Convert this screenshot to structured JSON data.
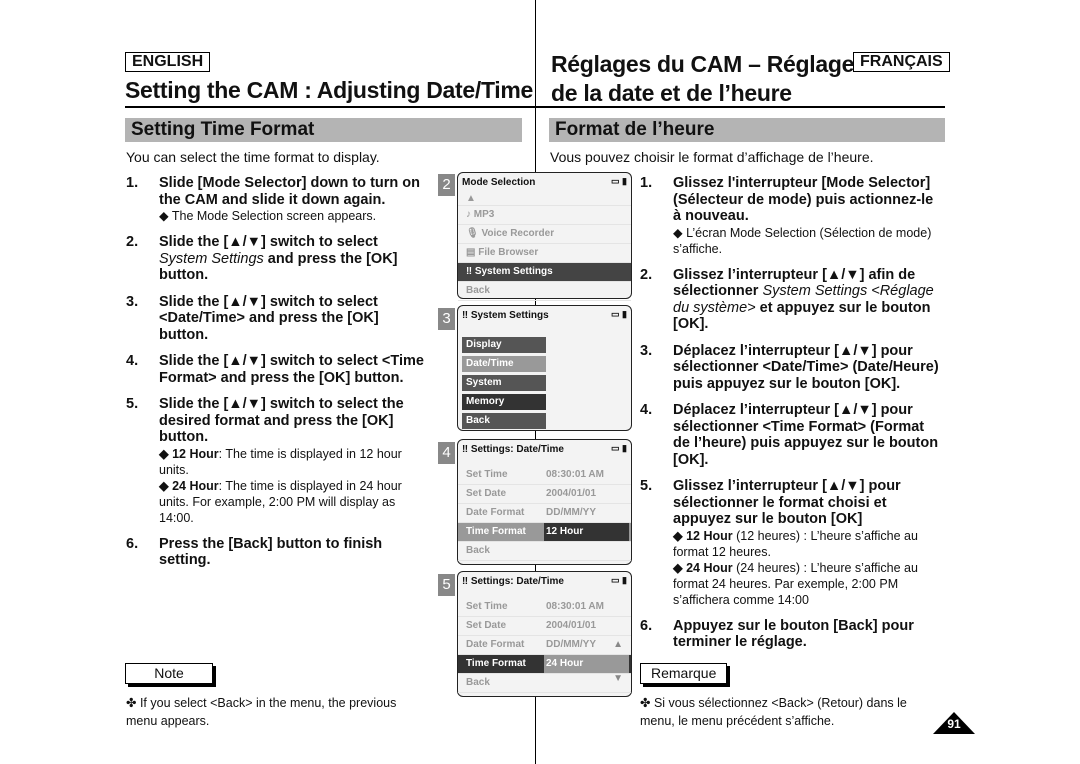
{
  "header": {
    "lang_en": "ENGLISH",
    "lang_fr": "FRANÇAIS",
    "title_en": "Setting the CAM : Adjusting Date/Time",
    "title_fr_1": "Réglages du CAM – Réglage",
    "title_fr_2": "de la date et de l’heure"
  },
  "en": {
    "section": "Setting Time Format",
    "intro": "You can select the time format to display.",
    "steps": [
      {
        "n": "1.",
        "text": "Slide [Mode Selector] down to turn on the CAM and slide it down again.",
        "sub": "◆ The Mode Selection screen appears."
      },
      {
        "n": "2.",
        "a": "Slide the [▲/▼] switch to select ",
        "i": "System Settings",
        "b": " and press the [OK] button."
      },
      {
        "n": "3.",
        "text": "Slide the [▲/▼] switch to select <Date/Time> and press the [OK] button."
      },
      {
        "n": "4.",
        "text": "Slide the [▲/▼] switch to select <Time Format> and press the [OK] button."
      },
      {
        "n": "5.",
        "text": "Slide the [▲/▼] switch to select the desired format and press the [OK] button.",
        "sub1_b": "◆ 12 Hour",
        "sub1": ": The time is displayed in 12 hour units.",
        "sub2_b": "◆ 24 Hour",
        "sub2": ": The time is displayed in 24 hour units. For example, 2:00 PM will display as 14:00."
      },
      {
        "n": "6.",
        "text": "Press the [Back] button to finish setting."
      }
    ],
    "note_label": "Note",
    "note": "✤  If you select <Back> in the menu, the previous menu appears."
  },
  "fr": {
    "section": "Format de l’heure",
    "intro": "Vous pouvez choisir le format d’affichage de l’heure.",
    "steps": [
      {
        "n": "1.",
        "text": "Glissez l'interrupteur [Mode Selector] (Sélecteur de mode) puis actionnez-le à nouveau.",
        "sub": "◆ L’écran Mode Selection (Sélection de mode) s’affiche."
      },
      {
        "n": "2.",
        "a": "Glissez l’interrupteur [▲/▼] afin de sélectionner ",
        "i": "System Settings <Réglage du système>",
        "b": " et appuyez sur le bouton [OK]."
      },
      {
        "n": "3.",
        "text": "Déplacez l’interrupteur [▲/▼] pour sélectionner <Date/Time> (Date/Heure) puis appuyez sur le bouton [OK]."
      },
      {
        "n": "4.",
        "text": "Déplacez l’interrupteur [▲/▼] pour sélectionner <Time Format> (Format de l’heure) puis appuyez sur le bouton [OK]."
      },
      {
        "n": "5.",
        "text": "Glissez l’interrupteur [▲/▼] pour sélectionner le format choisi et appuyez sur le bouton [OK]",
        "sub1_b": "◆ 12 Hour",
        "sub1": " (12 heures) : L’heure s’affiche au format 12 heures.",
        "sub2_b": "◆ 24 Hour",
        "sub2": " (24 heures) : L’heure s’affiche au format 24 heures. Par exemple, 2:00 PM s’affichera comme 14:00"
      },
      {
        "n": "6.",
        "text": "Appuyez sur le bouton [Back] pour terminer le réglage."
      }
    ],
    "note_label": "Remarque",
    "note": "✤  Si vous sélectionnez <Back> (Retour) dans le menu, le menu précédent s’affiche."
  },
  "screens": [
    {
      "num": "2",
      "title": "Mode Selection",
      "items": [
        "MP3",
        "Voice Recorder",
        "File Browser",
        "System Settings",
        "Back"
      ]
    },
    {
      "num": "3",
      "title": "System Settings",
      "items": [
        "Display",
        "Date/Time",
        "System",
        "Memory",
        "Back"
      ]
    },
    {
      "num": "4",
      "title": "Settings: Date/Time",
      "rows": [
        [
          "Set Time",
          "08:30:01 AM"
        ],
        [
          "Set Date",
          "2004/01/01"
        ],
        [
          "Date Format",
          "DD/MM/YY"
        ],
        [
          "Time Format",
          "12 Hour"
        ],
        [
          "Back",
          ""
        ]
      ]
    },
    {
      "num": "5",
      "title": "Settings: Date/Time",
      "rows": [
        [
          "Set Time",
          "08:30:01 AM"
        ],
        [
          "Set Date",
          "2004/01/01"
        ],
        [
          "Date Format",
          "DD/MM/YY"
        ],
        [
          "Time Format",
          "24 Hour"
        ],
        [
          "Back",
          ""
        ]
      ]
    }
  ],
  "page_number": "91"
}
